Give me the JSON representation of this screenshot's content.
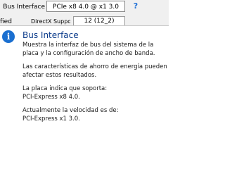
{
  "background": {
    "row1_label": "Bus Interface",
    "row1_value": "PCIe x8 4.0 @ x1 3.0",
    "help_glyph": "?",
    "row2_left": "fied",
    "row2_mid": "DirectX Support",
    "row2_value": "12 (12_2)"
  },
  "tooltip": {
    "icon": "info-icon",
    "title": "Bus Interface",
    "paragraphs": [
      "Muestra la interfaz de bus del sistema de la placa y la configuración de ancho de banda.",
      "Las características de ahorro de energía pueden afectar estos resultados.",
      "La placa indica que soporta:\nPCI-Express x8 4.0.",
      "Actualmente la velocidad es de:\nPCI-Express x1 3.0."
    ]
  },
  "colors": {
    "accent": "#1a6fd0",
    "title": "#0a3a8a",
    "help": "#1d6fd6"
  }
}
